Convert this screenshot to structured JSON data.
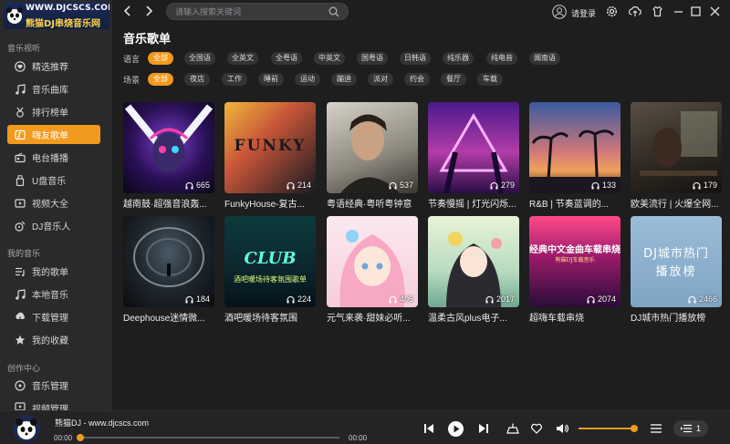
{
  "logo": {
    "url": "WWW.DJCSCS.COM",
    "name": "熊猫DJ串烧音乐网"
  },
  "sidebar": {
    "section1": "音乐视听",
    "items1": [
      {
        "label": "精选推荐",
        "icon": "heart-icon"
      },
      {
        "label": "音乐曲库",
        "icon": "music-note-icon"
      },
      {
        "label": "排行榜单",
        "icon": "medal-icon"
      },
      {
        "label": "嗨友歌单",
        "icon": "playlist-icon",
        "active": true
      },
      {
        "label": "电台播播",
        "icon": "radio-icon"
      },
      {
        "label": "U盘音乐",
        "icon": "usb-icon"
      },
      {
        "label": "视频大全",
        "icon": "video-icon"
      },
      {
        "label": "DJ音乐人",
        "icon": "dj-icon"
      }
    ],
    "section2": "我的音乐",
    "items2": [
      {
        "label": "我的歌单",
        "icon": "list-icon"
      },
      {
        "label": "本地音乐",
        "icon": "music-note-icon"
      },
      {
        "label": "下载管理",
        "icon": "download-icon"
      },
      {
        "label": "我的收藏",
        "icon": "star-icon"
      }
    ],
    "section3": "创作中心",
    "items3": [
      {
        "label": "音乐管理",
        "icon": "disc-icon"
      },
      {
        "label": "视频管理",
        "icon": "video-icon"
      }
    ]
  },
  "topbar": {
    "search_placeholder": "请输入搜索关键词",
    "login": "请登录"
  },
  "page": {
    "title": "音乐歌单",
    "language_label": "语言",
    "languages": [
      "全部",
      "全国语",
      "全英文",
      "全粤语",
      "中英文",
      "国粤语",
      "日韩语",
      "纯乐器",
      "纯电音",
      "闽南语"
    ],
    "scene_label": "场景",
    "scenes": [
      "全部",
      "夜店",
      "工作",
      "睡前",
      "运动",
      "蹦迪",
      "派对",
      "约会",
      "餐厅",
      "车载"
    ]
  },
  "playlists": [
    {
      "title": "越南鼓·超强音浪轰...",
      "plays": "665"
    },
    {
      "title": "FunkyHouse-复古...",
      "plays": "214",
      "cover_text": "FUNKY"
    },
    {
      "title": "粤语经典·粤听粤钟意",
      "plays": "537"
    },
    {
      "title": "节奏慢摇 | 灯光闪烁...",
      "plays": "279"
    },
    {
      "title": "R&B | 节奏蓝调的...",
      "plays": "133"
    },
    {
      "title": "欧美流行 | 火爆全网...",
      "plays": "179"
    },
    {
      "title": "Deephouse迷情微...",
      "plays": "184"
    },
    {
      "title": "酒吧暖场待客氛围",
      "plays": "224",
      "cover_text": "CLUB",
      "cover_sub": "酒吧暖场待客氛围歌单"
    },
    {
      "title": "元气来袭·甜妹必听...",
      "plays": "405"
    },
    {
      "title": "温柔古风plus电子...",
      "plays": "2017"
    },
    {
      "title": "超嗨车载串烧",
      "plays": "2074",
      "cover_text": "经典中文金曲车载串烧",
      "cover_sub": "熊猫DJ车载音乐"
    },
    {
      "title": "DJ城市热门播放榜",
      "plays": "2466",
      "cover_text": "DJ城市热门",
      "cover_sub": "播放榜"
    }
  ],
  "player": {
    "title": "熊猫DJ - www.djcscs.com",
    "current": "00:00",
    "duration": "00:00",
    "progress": 0,
    "volume": 0.95,
    "queue_count": "1"
  },
  "colors": {
    "accent": "#f29a1d",
    "bg": "#1e1e1f",
    "sidebar": "#2a2a2c"
  }
}
